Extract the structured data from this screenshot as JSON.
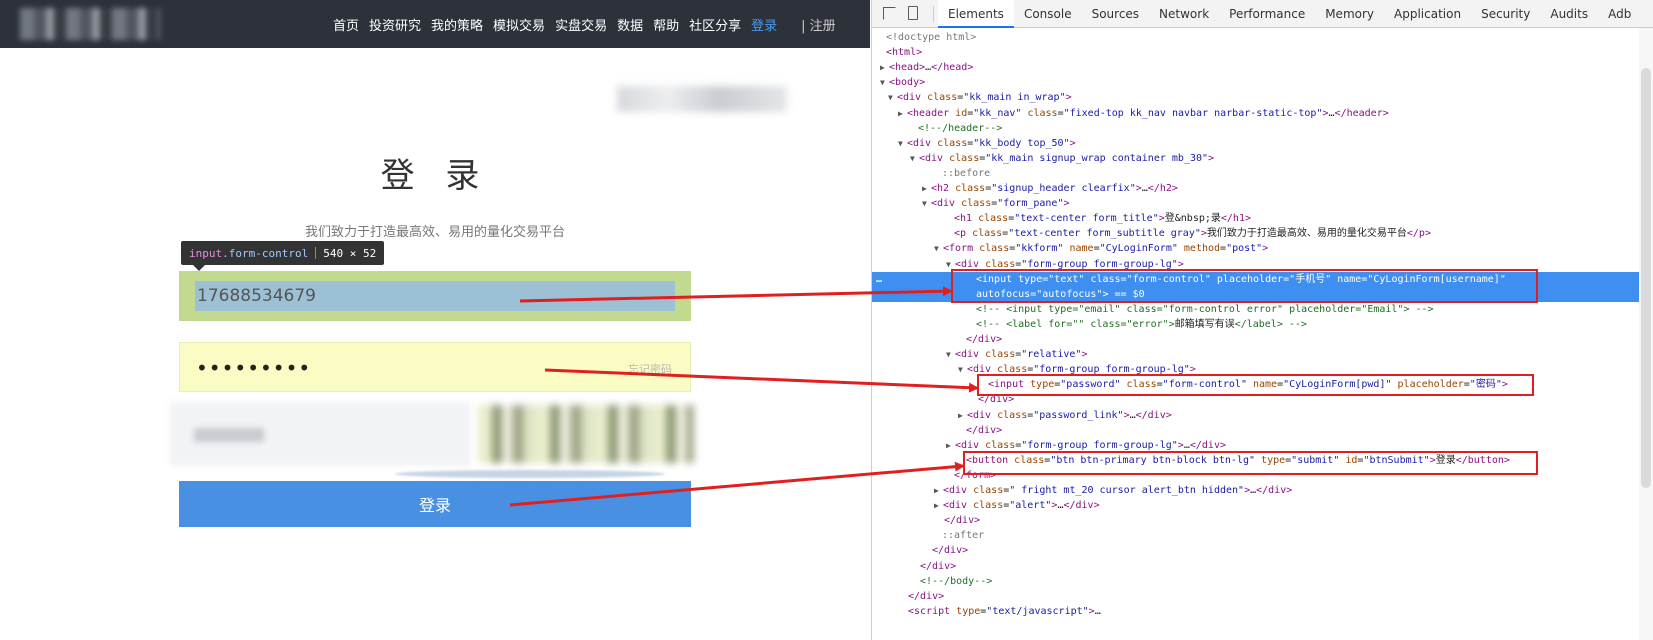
{
  "site": {
    "nav": [
      "首页",
      "投资研究",
      "我的策略",
      "模拟交易",
      "实盘交易",
      "数据",
      "帮助",
      "社区分享",
      "登录"
    ],
    "nav_register": "| 注册",
    "title": "登 录",
    "subtitle": "我们致力于打造最高效、易用的量化交易平台",
    "tooltip": {
      "tag": "input",
      "cls": ".form-control",
      "size": "540 × 52"
    },
    "username_value": "17688534679",
    "password_mask": "•••••••••",
    "forgot_password": "忘记密码",
    "login_button": "登录"
  },
  "devtools": {
    "tabs": [
      "Elements",
      "Console",
      "Sources",
      "Network",
      "Performance",
      "Memory",
      "Application",
      "Security",
      "Audits",
      "Adb"
    ],
    "active_tab": "Elements"
  },
  "colors": {
    "nav_bg": "#2c313a",
    "accent": "#4a90e2",
    "username_highlight": "#c2d990",
    "password_bg": "#fafcc4",
    "selection": "#3f8ff0",
    "annotation_red": "#e02020"
  }
}
